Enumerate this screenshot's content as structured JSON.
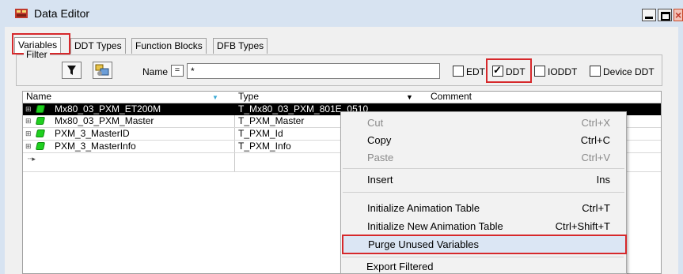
{
  "window": {
    "title": "Data Editor"
  },
  "tabs": [
    {
      "label": "Variables",
      "active": true
    },
    {
      "label": "DDT Types",
      "active": false
    },
    {
      "label": "Function Blocks",
      "active": false
    },
    {
      "label": "DFB Types",
      "active": false
    }
  ],
  "filter": {
    "group_label": "Filter",
    "name_label": "Name",
    "operator": "=",
    "value": "*",
    "checkboxes": [
      {
        "label": "EDT",
        "checked": false
      },
      {
        "label": "DDT",
        "checked": true
      },
      {
        "label": "IODDT",
        "checked": false
      },
      {
        "label": "Device DDT",
        "checked": false
      }
    ]
  },
  "table": {
    "columns": {
      "name": "Name",
      "type": "Type",
      "comment": "Comment"
    },
    "rows": [
      {
        "name": "Mx80_03_PXM_ET200M",
        "type": "T_Mx80_03_PXM_801E_0510",
        "selected": true
      },
      {
        "name": "Mx80_03_PXM_Master",
        "type": "T_PXM_Master",
        "selected": false
      },
      {
        "name": "PXM_3_MasterID",
        "type": "T_PXM_Id",
        "selected": false
      },
      {
        "name": "PXM_3_MasterInfo",
        "type": "T_PXM_Info",
        "selected": false
      }
    ]
  },
  "context_menu": {
    "items": [
      {
        "label": "Cut",
        "shortcut": "Ctrl+X",
        "enabled": false
      },
      {
        "label": "Copy",
        "shortcut": "Ctrl+C",
        "enabled": true
      },
      {
        "label": "Paste",
        "shortcut": "Ctrl+V",
        "enabled": false
      },
      {
        "label": "Insert",
        "shortcut": "Ins",
        "enabled": true
      },
      {
        "label": "Initialize Animation Table",
        "shortcut": "Ctrl+T",
        "enabled": true
      },
      {
        "label": "Initialize New Animation Table",
        "shortcut": "Ctrl+Shift+T",
        "enabled": true
      },
      {
        "label": "Purge Unused Variables",
        "shortcut": "",
        "enabled": true
      },
      {
        "label": "Export Filtered",
        "shortcut": "",
        "enabled": true
      }
    ]
  },
  "colors": {
    "titlebar": "#d7e3f1",
    "highlight": "#d6282b",
    "var_icon": "#1fd01f"
  }
}
